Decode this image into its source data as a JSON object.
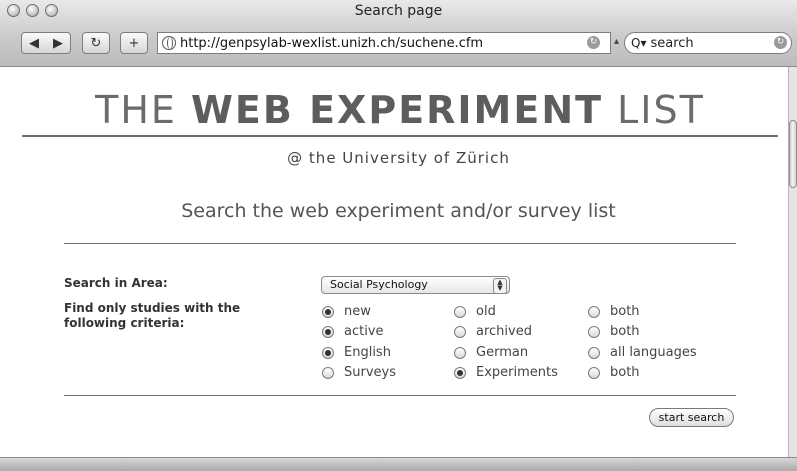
{
  "window": {
    "title": "Search page"
  },
  "toolbar": {
    "back_glyph": "◀",
    "forward_glyph": "▶",
    "reload_glyph": "↻",
    "add_glyph": "+",
    "url": "http://genpsylab-wexlist.unizh.ch/suchene.cfm",
    "search_placeholder": "search",
    "search_icon": "Q▾"
  },
  "page": {
    "title_pre": "THE ",
    "title_bold": "WEB EXPERIMENT",
    "title_post": " LIST",
    "subtitle": "@ the  University of Zürich",
    "heading": "Search the web experiment and/or survey list",
    "area_label": "Search in Area:",
    "area_value": "Social Psychology",
    "criteria_label_1": "Find only studies with the",
    "criteria_label_2": "following criteria:",
    "criteria": [
      {
        "options": [
          {
            "label": "new",
            "checked": true
          },
          {
            "label": "old",
            "checked": false
          },
          {
            "label": "both",
            "checked": false
          }
        ]
      },
      {
        "options": [
          {
            "label": "active",
            "checked": true
          },
          {
            "label": "archived",
            "checked": false
          },
          {
            "label": "both",
            "checked": false
          }
        ]
      },
      {
        "options": [
          {
            "label": "English",
            "checked": true
          },
          {
            "label": "German",
            "checked": false
          },
          {
            "label": "all languages",
            "checked": false
          }
        ]
      },
      {
        "options": [
          {
            "label": "Surveys",
            "checked": false
          },
          {
            "label": "Experiments",
            "checked": true
          },
          {
            "label": "both",
            "checked": false
          }
        ]
      }
    ],
    "submit_label": "start search"
  }
}
